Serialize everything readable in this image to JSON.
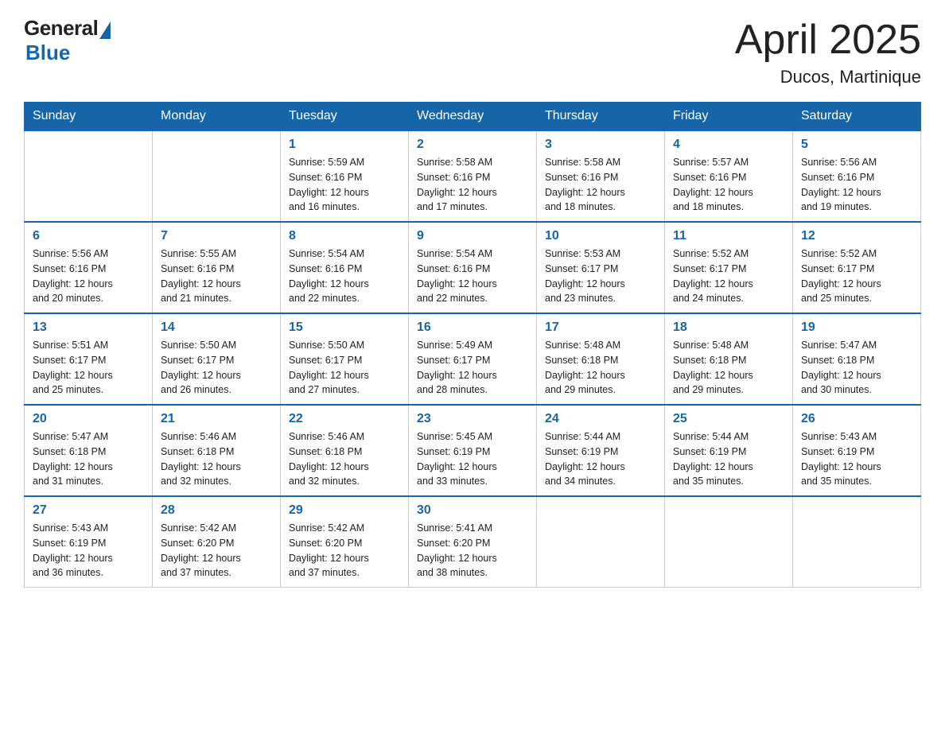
{
  "header": {
    "logo_general": "General",
    "logo_blue": "Blue",
    "month_title": "April 2025",
    "location": "Ducos, Martinique"
  },
  "weekdays": [
    "Sunday",
    "Monday",
    "Tuesday",
    "Wednesday",
    "Thursday",
    "Friday",
    "Saturday"
  ],
  "weeks": [
    [
      {
        "day": "",
        "info": ""
      },
      {
        "day": "",
        "info": ""
      },
      {
        "day": "1",
        "info": "Sunrise: 5:59 AM\nSunset: 6:16 PM\nDaylight: 12 hours\nand 16 minutes."
      },
      {
        "day": "2",
        "info": "Sunrise: 5:58 AM\nSunset: 6:16 PM\nDaylight: 12 hours\nand 17 minutes."
      },
      {
        "day": "3",
        "info": "Sunrise: 5:58 AM\nSunset: 6:16 PM\nDaylight: 12 hours\nand 18 minutes."
      },
      {
        "day": "4",
        "info": "Sunrise: 5:57 AM\nSunset: 6:16 PM\nDaylight: 12 hours\nand 18 minutes."
      },
      {
        "day": "5",
        "info": "Sunrise: 5:56 AM\nSunset: 6:16 PM\nDaylight: 12 hours\nand 19 minutes."
      }
    ],
    [
      {
        "day": "6",
        "info": "Sunrise: 5:56 AM\nSunset: 6:16 PM\nDaylight: 12 hours\nand 20 minutes."
      },
      {
        "day": "7",
        "info": "Sunrise: 5:55 AM\nSunset: 6:16 PM\nDaylight: 12 hours\nand 21 minutes."
      },
      {
        "day": "8",
        "info": "Sunrise: 5:54 AM\nSunset: 6:16 PM\nDaylight: 12 hours\nand 22 minutes."
      },
      {
        "day": "9",
        "info": "Sunrise: 5:54 AM\nSunset: 6:16 PM\nDaylight: 12 hours\nand 22 minutes."
      },
      {
        "day": "10",
        "info": "Sunrise: 5:53 AM\nSunset: 6:17 PM\nDaylight: 12 hours\nand 23 minutes."
      },
      {
        "day": "11",
        "info": "Sunrise: 5:52 AM\nSunset: 6:17 PM\nDaylight: 12 hours\nand 24 minutes."
      },
      {
        "day": "12",
        "info": "Sunrise: 5:52 AM\nSunset: 6:17 PM\nDaylight: 12 hours\nand 25 minutes."
      }
    ],
    [
      {
        "day": "13",
        "info": "Sunrise: 5:51 AM\nSunset: 6:17 PM\nDaylight: 12 hours\nand 25 minutes."
      },
      {
        "day": "14",
        "info": "Sunrise: 5:50 AM\nSunset: 6:17 PM\nDaylight: 12 hours\nand 26 minutes."
      },
      {
        "day": "15",
        "info": "Sunrise: 5:50 AM\nSunset: 6:17 PM\nDaylight: 12 hours\nand 27 minutes."
      },
      {
        "day": "16",
        "info": "Sunrise: 5:49 AM\nSunset: 6:17 PM\nDaylight: 12 hours\nand 28 minutes."
      },
      {
        "day": "17",
        "info": "Sunrise: 5:48 AM\nSunset: 6:18 PM\nDaylight: 12 hours\nand 29 minutes."
      },
      {
        "day": "18",
        "info": "Sunrise: 5:48 AM\nSunset: 6:18 PM\nDaylight: 12 hours\nand 29 minutes."
      },
      {
        "day": "19",
        "info": "Sunrise: 5:47 AM\nSunset: 6:18 PM\nDaylight: 12 hours\nand 30 minutes."
      }
    ],
    [
      {
        "day": "20",
        "info": "Sunrise: 5:47 AM\nSunset: 6:18 PM\nDaylight: 12 hours\nand 31 minutes."
      },
      {
        "day": "21",
        "info": "Sunrise: 5:46 AM\nSunset: 6:18 PM\nDaylight: 12 hours\nand 32 minutes."
      },
      {
        "day": "22",
        "info": "Sunrise: 5:46 AM\nSunset: 6:18 PM\nDaylight: 12 hours\nand 32 minutes."
      },
      {
        "day": "23",
        "info": "Sunrise: 5:45 AM\nSunset: 6:19 PM\nDaylight: 12 hours\nand 33 minutes."
      },
      {
        "day": "24",
        "info": "Sunrise: 5:44 AM\nSunset: 6:19 PM\nDaylight: 12 hours\nand 34 minutes."
      },
      {
        "day": "25",
        "info": "Sunrise: 5:44 AM\nSunset: 6:19 PM\nDaylight: 12 hours\nand 35 minutes."
      },
      {
        "day": "26",
        "info": "Sunrise: 5:43 AM\nSunset: 6:19 PM\nDaylight: 12 hours\nand 35 minutes."
      }
    ],
    [
      {
        "day": "27",
        "info": "Sunrise: 5:43 AM\nSunset: 6:19 PM\nDaylight: 12 hours\nand 36 minutes."
      },
      {
        "day": "28",
        "info": "Sunrise: 5:42 AM\nSunset: 6:20 PM\nDaylight: 12 hours\nand 37 minutes."
      },
      {
        "day": "29",
        "info": "Sunrise: 5:42 AM\nSunset: 6:20 PM\nDaylight: 12 hours\nand 37 minutes."
      },
      {
        "day": "30",
        "info": "Sunrise: 5:41 AM\nSunset: 6:20 PM\nDaylight: 12 hours\nand 38 minutes."
      },
      {
        "day": "",
        "info": ""
      },
      {
        "day": "",
        "info": ""
      },
      {
        "day": "",
        "info": ""
      }
    ]
  ]
}
